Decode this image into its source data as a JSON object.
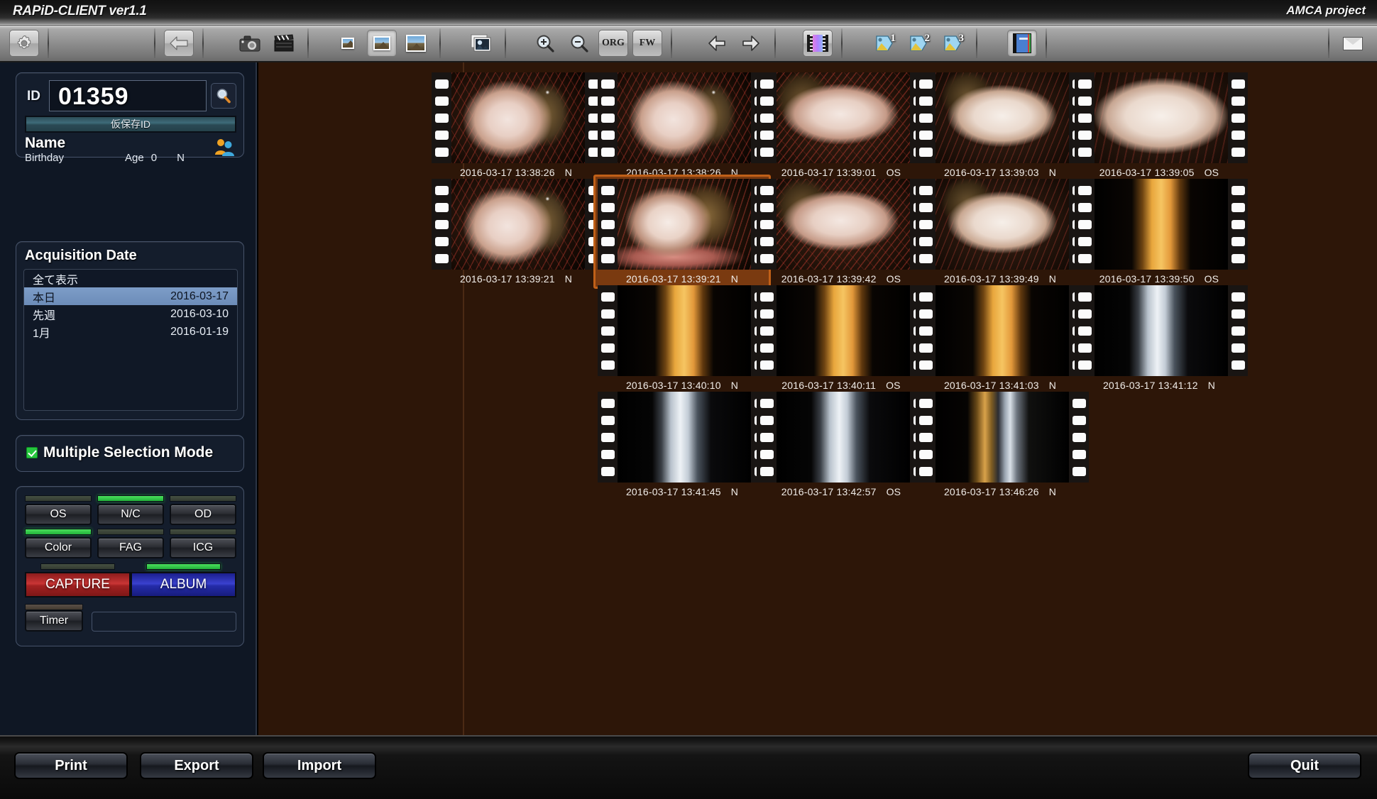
{
  "titlebar": {
    "app_title": "RAPiD-CLIENT ver1.1",
    "project_title": "AMCA project"
  },
  "toolbar": {
    "settings_icon": "gear-icon",
    "back_icon": "arrow-left-icon",
    "capture_icon": "camera-icon",
    "movie_icon": "clapperboard-icon",
    "view_small_icon": "photo-small-icon",
    "view_medium_icon": "photo-medium-icon",
    "view_large_icon": "photo-large-icon",
    "stack_icon": "photo-stack-icon",
    "zoom_in_icon": "magnifier-plus-icon",
    "zoom_out_icon": "magnifier-minus-icon",
    "org_label": "ORG",
    "fw_label": "FW",
    "prev_icon": "arrow-left-nav-icon",
    "next_icon": "arrow-right-nav-icon",
    "film_icon": "film-strip-icon",
    "tag1_label": "1",
    "tag2_label": "2",
    "tag3_label": "3",
    "album_icon": "album-book-icon",
    "mail_icon": "mail-icon"
  },
  "sidebar": {
    "id_label": "ID",
    "id_value": "01359",
    "id_search_icon": "magnifier-icon",
    "temp_id_button": "仮保存ID",
    "name_label": "Name",
    "birthday_label": "Birthday",
    "age_label": "Age",
    "age_value": "0",
    "sex_value": "N",
    "person_icon": "person-group-icon",
    "acquisition": {
      "title": "Acquisition Date",
      "rows": [
        {
          "label": "全て表示",
          "date": "",
          "selected": false
        },
        {
          "label": "本日",
          "date": "2016-03-17",
          "selected": true
        },
        {
          "label": "先週",
          "date": "2016-03-10",
          "selected": false
        },
        {
          "label": "1月",
          "date": "2016-01-19",
          "selected": false
        }
      ]
    },
    "multiple_selection": {
      "label": "Multiple Selection Mode",
      "checked": true
    },
    "modes": [
      {
        "label": "OS",
        "led": "off"
      },
      {
        "label": "N/C",
        "led": "on"
      },
      {
        "label": "OD",
        "led": "off"
      },
      {
        "label": "Color",
        "led": "on"
      },
      {
        "label": "FAG",
        "led": "off"
      },
      {
        "label": "ICG",
        "led": "off"
      }
    ],
    "capture_button": "CAPTURE",
    "capture_led": "off",
    "album_button": "ALBUM",
    "album_led": "on",
    "timer_button": "Timer",
    "timer_led": "dim",
    "timer_value": ""
  },
  "thumbnails": [
    {
      "date": "2016-03-17",
      "time": "13:38:26",
      "eye": "N",
      "kind": "conj-red",
      "selected": false,
      "col": 0,
      "row": 0
    },
    {
      "date": "2016-03-17",
      "time": "13:38:26",
      "eye": "N",
      "kind": "conj-red",
      "selected": false,
      "col": 1,
      "row": 0
    },
    {
      "date": "2016-03-17",
      "time": "13:39:01",
      "eye": "OS",
      "kind": "conj-wide",
      "selected": false,
      "col": 2,
      "row": 0
    },
    {
      "date": "2016-03-17",
      "time": "13:39:03",
      "eye": "N",
      "kind": "conj-pale",
      "selected": false,
      "col": 3,
      "row": 0
    },
    {
      "date": "2016-03-17",
      "time": "13:39:05",
      "eye": "OS",
      "kind": "conj-blur",
      "selected": false,
      "col": 4,
      "row": 0
    },
    {
      "date": "2016-03-17",
      "time": "13:39:21",
      "eye": "N",
      "kind": "conj-red",
      "selected": false,
      "col": 0,
      "row": 1
    },
    {
      "date": "2016-03-17",
      "time": "13:39:21",
      "eye": "N",
      "kind": "conj-sel",
      "selected": true,
      "col": 1,
      "row": 1
    },
    {
      "date": "2016-03-17",
      "time": "13:39:42",
      "eye": "OS",
      "kind": "conj-wide",
      "selected": false,
      "col": 2,
      "row": 1
    },
    {
      "date": "2016-03-17",
      "time": "13:39:49",
      "eye": "N",
      "kind": "conj-pale",
      "selected": false,
      "col": 3,
      "row": 1
    },
    {
      "date": "2016-03-17",
      "time": "13:39:50",
      "eye": "OS",
      "kind": "slit-orange",
      "selected": false,
      "col": 4,
      "row": 1
    },
    {
      "date": "2016-03-17",
      "time": "13:40:10",
      "eye": "N",
      "kind": "slit-orange",
      "selected": false,
      "col": 1,
      "row": 2
    },
    {
      "date": "2016-03-17",
      "time": "13:40:11",
      "eye": "OS",
      "kind": "slit-orange",
      "selected": false,
      "col": 2,
      "row": 2
    },
    {
      "date": "2016-03-17",
      "time": "13:41:03",
      "eye": "N",
      "kind": "slit-orange",
      "selected": false,
      "col": 3,
      "row": 2
    },
    {
      "date": "2016-03-17",
      "time": "13:41:12",
      "eye": "N",
      "kind": "slit-white",
      "selected": false,
      "col": 4,
      "row": 2
    },
    {
      "date": "2016-03-17",
      "time": "13:41:45",
      "eye": "N",
      "kind": "slit-white",
      "selected": false,
      "col": 1,
      "row": 3
    },
    {
      "date": "2016-03-17",
      "time": "13:42:57",
      "eye": "OS",
      "kind": "slit-white",
      "selected": false,
      "col": 2,
      "row": 3
    },
    {
      "date": "2016-03-17",
      "time": "13:46:26",
      "eye": "N",
      "kind": "slit-thin",
      "selected": false,
      "col": 3,
      "row": 3
    }
  ],
  "bottombar": {
    "print": "Print",
    "export": "Export",
    "import": "Import",
    "quit": "Quit"
  },
  "colors": {
    "accent_orange": "#c06018",
    "main_bg": "#2d1608",
    "panel_bg": "#141d2c",
    "led_on": "#27c63f",
    "capture_red": "#c93535",
    "album_blue": "#3a41cf"
  }
}
